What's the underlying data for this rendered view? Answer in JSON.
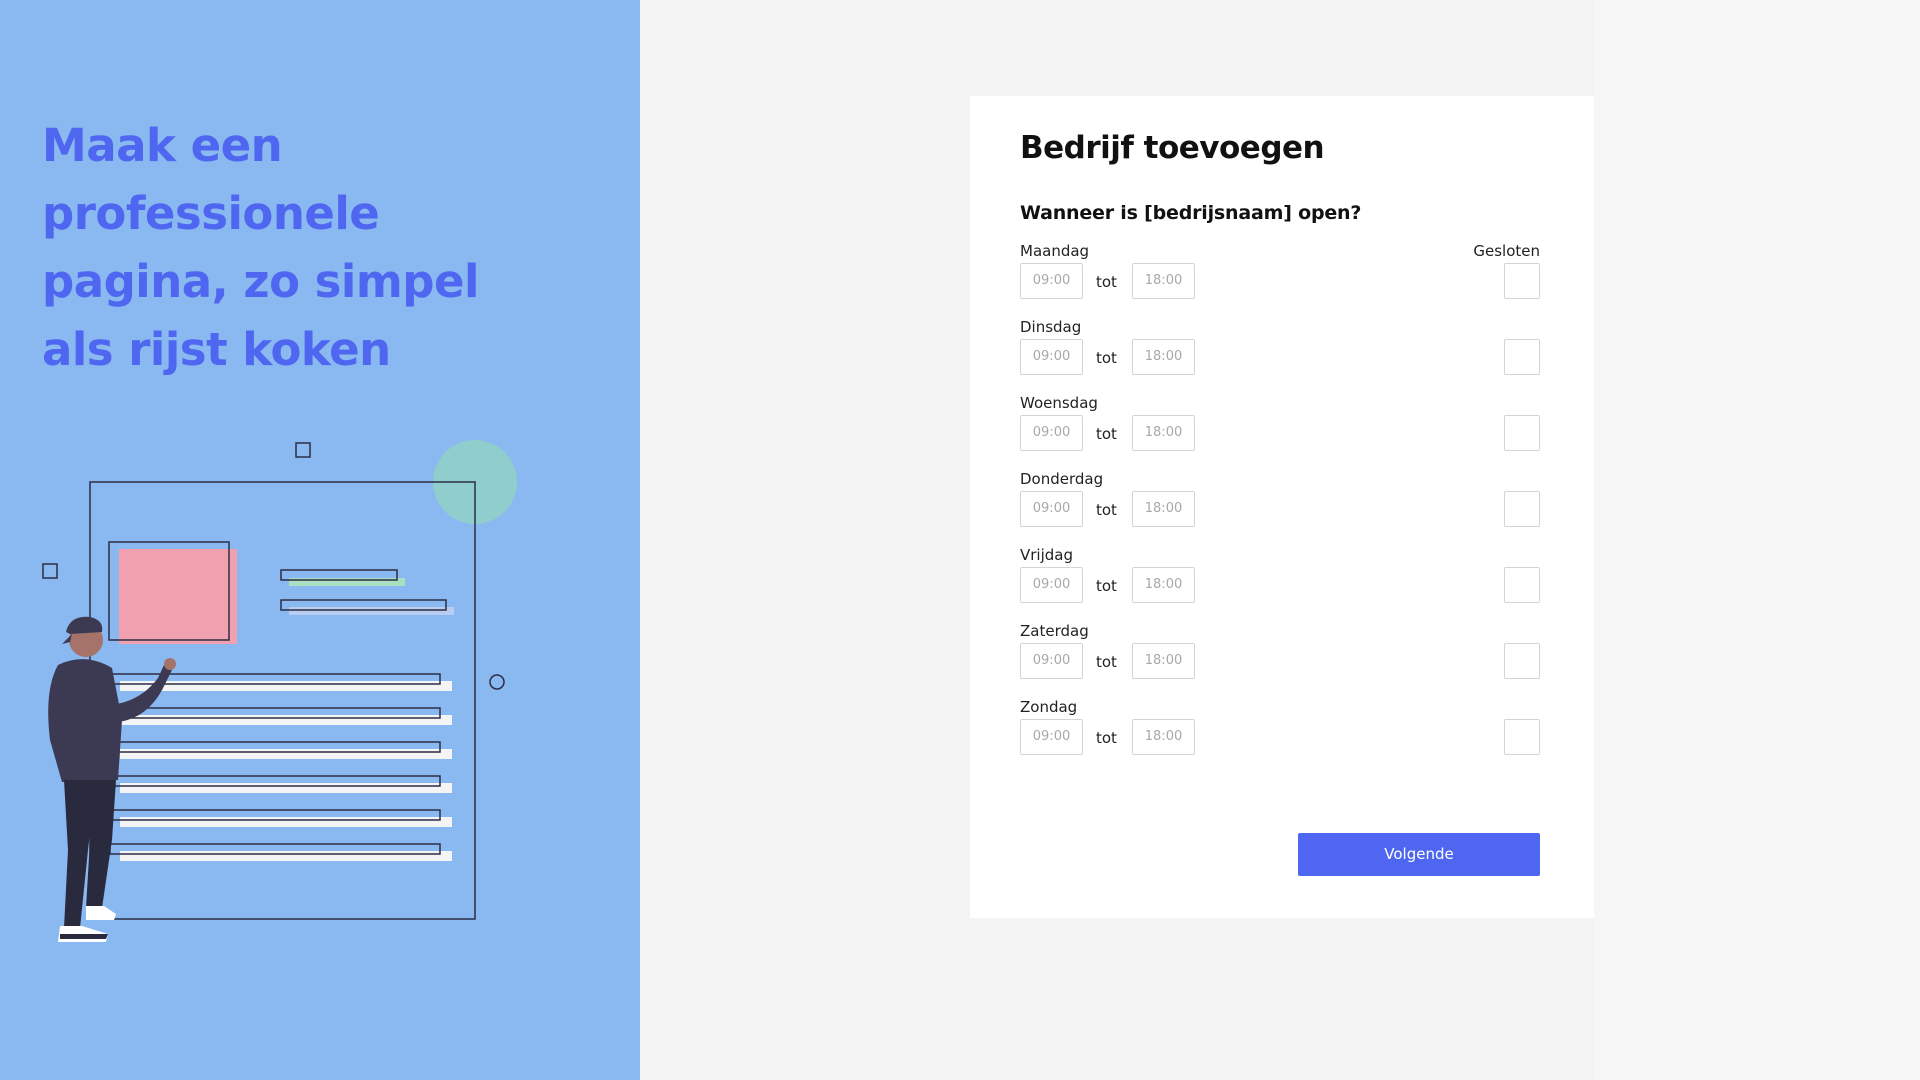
{
  "hero": {
    "headline": "Maak een professionele pagina, zo simpel als rijst koken"
  },
  "form": {
    "title": "Bedrijf toevoegen",
    "question": "Wanneer is [bedrijsnaam] open?",
    "closed_header": "Gesloten",
    "separator": "tot",
    "days": [
      {
        "label": "Maandag",
        "from_placeholder": "09:00",
        "to_placeholder": "18:00"
      },
      {
        "label": "Dinsdag",
        "from_placeholder": "09:00",
        "to_placeholder": "18:00"
      },
      {
        "label": "Woensdag",
        "from_placeholder": "09:00",
        "to_placeholder": "18:00"
      },
      {
        "label": "Donderdag",
        "from_placeholder": "09:00",
        "to_placeholder": "18:00"
      },
      {
        "label": "Vrijdag",
        "from_placeholder": "09:00",
        "to_placeholder": "18:00"
      },
      {
        "label": "Zaterdag",
        "from_placeholder": "09:00",
        "to_placeholder": "18:00"
      },
      {
        "label": "Zondag",
        "from_placeholder": "09:00",
        "to_placeholder": "18:00"
      }
    ],
    "next_label": "Volgende"
  },
  "colors": {
    "left_panel_bg": "#8ab8f0",
    "accent": "#4f66f0",
    "card_bg": "#ffffff",
    "page_bg": "#f4f4f4"
  }
}
